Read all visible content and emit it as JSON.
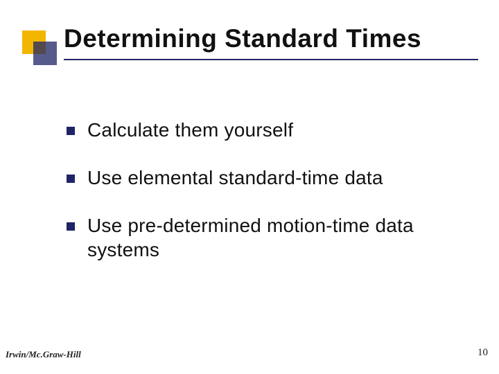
{
  "title": "Determining Standard Times",
  "bullets": [
    "Calculate them yourself",
    "Use elemental standard-time data",
    "Use pre-determined motion-time data systems"
  ],
  "footer": {
    "left": "Irwin/Mc.Graw-Hill",
    "right": "10"
  }
}
